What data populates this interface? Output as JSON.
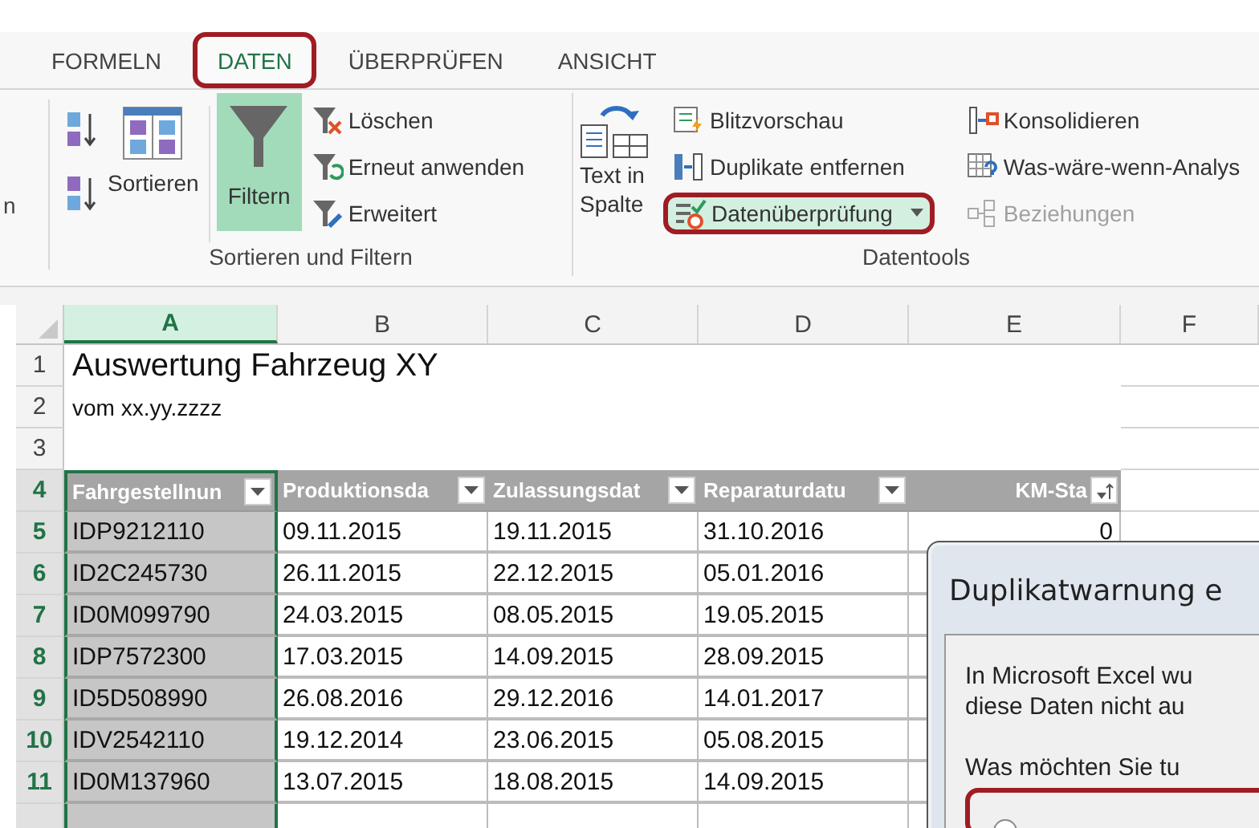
{
  "ribbon_tabs": [
    {
      "label": "FORMELN",
      "selected": false,
      "annotated": false
    },
    {
      "label": "DATEN",
      "selected": true,
      "annotated": true
    },
    {
      "label": "ÜBERPRÜFEN",
      "selected": false,
      "annotated": false
    },
    {
      "label": "ANSICHT",
      "selected": false,
      "annotated": false
    }
  ],
  "cut_group_label": "n",
  "sort_filter": {
    "sort_label": "Sortieren",
    "filter": {
      "label": "Filtern",
      "selected": true
    },
    "items": [
      "Löschen",
      "Erneut anwenden",
      "Erweitert"
    ],
    "title": "Sortieren und Filtern"
  },
  "datentools": {
    "text_to_columns": [
      "Text in",
      "Spalte"
    ],
    "column_1": [
      {
        "label": "Blitzvorschau",
        "annotated": false
      },
      {
        "label": "Duplikate entfernen",
        "annotated": false
      },
      {
        "label": "Datenüberprüfung",
        "annotated": true
      }
    ],
    "column_2": [
      {
        "label": "Konsolidieren",
        "disabled": false
      },
      {
        "label": "Was-wäre-wenn-Analys",
        "disabled": false
      },
      {
        "label": "Beziehungen",
        "disabled": true
      }
    ],
    "title": "Datentools"
  },
  "sheet": {
    "columns": [
      {
        "label": "A",
        "selected": true
      },
      {
        "label": "B",
        "selected": false
      },
      {
        "label": "C",
        "selected": false
      },
      {
        "label": "D",
        "selected": false
      },
      {
        "label": "E",
        "selected": false
      },
      {
        "label": "F",
        "selected": false
      }
    ],
    "rows": [
      {
        "number": "1",
        "selected": false,
        "kind": "title",
        "cells": [
          "Auswertung Fahrzeug XY"
        ]
      },
      {
        "number": "2",
        "selected": false,
        "kind": "subtitle",
        "cells": [
          "vom xx.yy.zzzz"
        ]
      },
      {
        "number": "3",
        "selected": false,
        "kind": "blank",
        "cells": []
      },
      {
        "number": "4",
        "selected": true,
        "kind": "header",
        "cells": [
          {
            "text": "Fahrgestellnun",
            "kind": "dropdown"
          },
          {
            "text": "Produktionsda",
            "kind": "dropdown"
          },
          {
            "text": "Zulassungsdat",
            "kind": "dropdown"
          },
          {
            "text": "Reparaturdatu",
            "kind": "dropdown"
          },
          {
            "text": "KM-Sta",
            "kind": "sorted"
          }
        ]
      },
      {
        "number": "5",
        "selected": true,
        "kind": "data",
        "cells": [
          "IDP9212110",
          "09.11.2015",
          "19.11.2015",
          "31.10.2016",
          "0"
        ]
      },
      {
        "number": "6",
        "selected": true,
        "kind": "data",
        "cells": [
          "ID2C245730",
          "26.11.2015",
          "22.12.2015",
          "05.01.2016"
        ]
      },
      {
        "number": "7",
        "selected": true,
        "kind": "data",
        "cells": [
          "ID0M099790",
          "24.03.2015",
          "08.05.2015",
          "19.05.2015"
        ]
      },
      {
        "number": "8",
        "selected": true,
        "kind": "data",
        "cells": [
          "IDP7572300",
          "17.03.2015",
          "14.09.2015",
          "28.09.2015"
        ]
      },
      {
        "number": "9",
        "selected": true,
        "kind": "data",
        "cells": [
          "ID5D508990",
          "26.08.2016",
          "29.12.2016",
          "14.01.2017"
        ]
      },
      {
        "number": "10",
        "selected": true,
        "kind": "data",
        "cells": [
          "IDV2542110",
          "19.12.2014",
          "23.06.2015",
          "05.08.2015"
        ]
      },
      {
        "number": "11",
        "selected": true,
        "kind": "data",
        "cells": [
          "ID0M137960",
          "13.07.2015",
          "18.08.2015",
          "14.09.2015"
        ]
      }
    ]
  },
  "dialog": {
    "title": "Duplikatwarnung e",
    "message": [
      "In Microsoft Excel wu",
      "diese Daten nicht au"
    ],
    "question": "Was möchten Sie tu",
    "option": {
      "annotated": true
    }
  }
}
